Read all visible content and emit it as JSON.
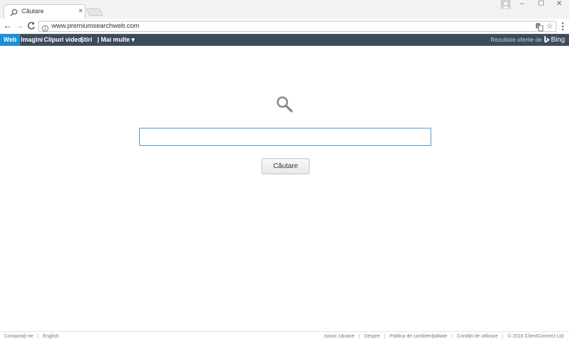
{
  "browser": {
    "tab_title": "Căutare",
    "tab_close": "×",
    "url": "www.premiumsearchweb.com",
    "window_controls": {
      "minimize": "–",
      "maximize": "☐",
      "close": "✕"
    },
    "nav": {
      "back": "←",
      "forward": "→",
      "reload": "C"
    },
    "star": "☆"
  },
  "sitebar": {
    "tabs": [
      "Web",
      "Imagini",
      "Clipuri video",
      "Ştiri",
      "| Mai multe ▾"
    ],
    "active_tab": "Web",
    "powered_by": "Rezultate oferite de",
    "powered_brand": "Bing"
  },
  "search": {
    "input_value": "",
    "button_label": "Căutare"
  },
  "footer": {
    "left_links": [
      "Contactaţi-ne",
      "English"
    ],
    "right_links": [
      "Istoric căutare",
      "Despre",
      "Politica de confidenţialitate",
      "Condiţii de utilizare",
      "© 2016 ClientConnect Ltd"
    ]
  },
  "colors": {
    "sitebar_bg": "#3d4c5b",
    "active_tab_bg": "#1a8fd8",
    "input_border": "#4a9ad6"
  },
  "icons": {
    "tab_favicon": "search-icon",
    "main_glyph": "search-icon",
    "omnibox_left": "info-icon",
    "omnibox_right": [
      "translate-icon",
      "star-icon"
    ],
    "menu": "kebab-menu-icon",
    "brand": "bing-logo-icon"
  }
}
